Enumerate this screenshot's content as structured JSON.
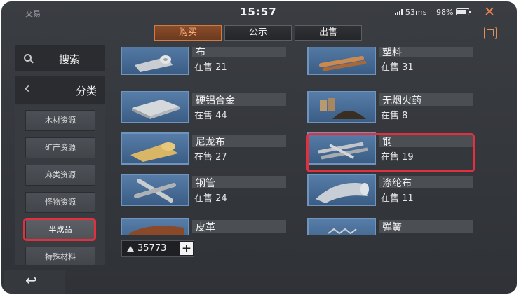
{
  "status_bar": {
    "app_title": "交易",
    "time": "15:57",
    "ping": "53ms",
    "battery": "98%"
  },
  "tabs": [
    {
      "label": "购买",
      "active": true
    },
    {
      "label": "公示",
      "active": false
    },
    {
      "label": "出售",
      "active": false
    }
  ],
  "sidebar": {
    "search_label": "搜索",
    "category_label": "分类",
    "items": [
      {
        "label": "木材资源",
        "selected": false
      },
      {
        "label": "矿产资源",
        "selected": false
      },
      {
        "label": "麻类资源",
        "selected": false
      },
      {
        "label": "怪物资源",
        "selected": false
      },
      {
        "label": "半成品",
        "selected": true
      },
      {
        "label": "特殊材料",
        "selected": false
      }
    ]
  },
  "items": [
    {
      "name": "布",
      "count": "在售 21",
      "icon": "cloth-roll-icon"
    },
    {
      "name": "塑料",
      "count": "在售 31",
      "icon": "plastic-rods-icon"
    },
    {
      "name": "硬铝合金",
      "count": "在售 44",
      "icon": "alloy-plate-icon"
    },
    {
      "name": "无烟火药",
      "count": "在售 8",
      "icon": "gunpowder-icon"
    },
    {
      "name": "尼龙布",
      "count": "在售 27",
      "icon": "nylon-roll-icon"
    },
    {
      "name": "钢",
      "count": "在售 19",
      "icon": "steel-bars-icon"
    },
    {
      "name": "钢管",
      "count": "在售 24",
      "icon": "steel-pipe-icon"
    },
    {
      "name": "涤纶布",
      "count": "在售 11",
      "icon": "polyester-cloth-icon"
    },
    {
      "name": "皮革",
      "count": "",
      "icon": "leather-icon"
    },
    {
      "name": "弹簧",
      "count": "",
      "icon": "spring-icon"
    }
  ],
  "currency": {
    "amount": "35773",
    "add_symbol": "+"
  },
  "colors": {
    "accent": "#d17a42",
    "highlight": "#e2303f",
    "thumb_bg": "#4a6e98"
  }
}
